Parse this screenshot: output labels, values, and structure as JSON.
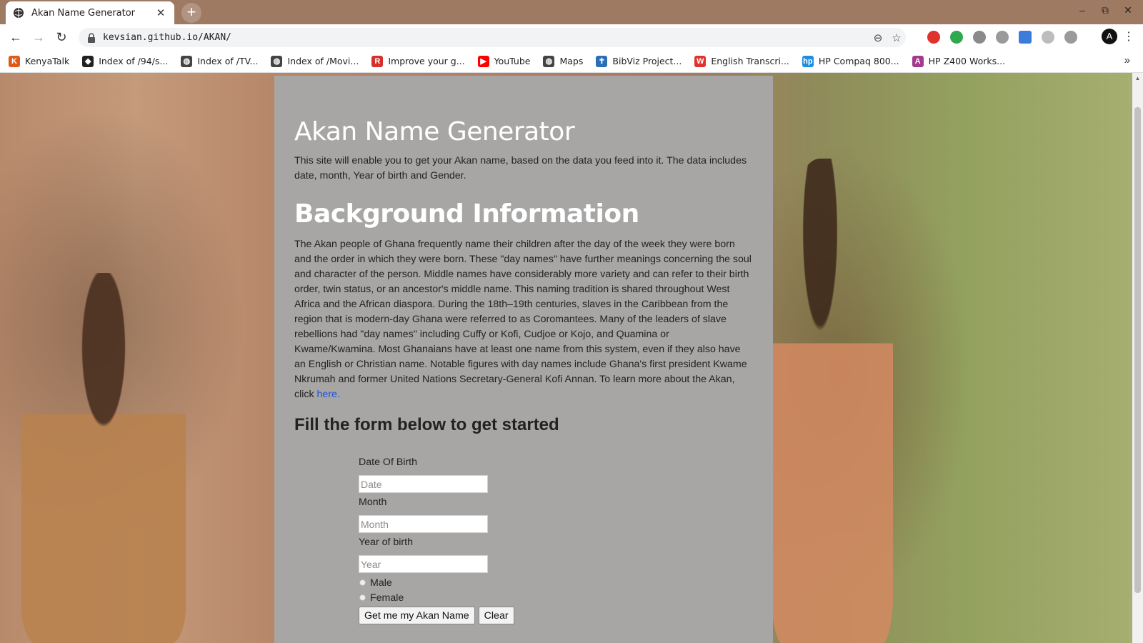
{
  "browser": {
    "tab_title": "Akan Name Generator",
    "tab_close": "✕",
    "new_tab": "+",
    "url": "kevsian.github.io/AKAN/",
    "window_controls": {
      "minimize": "–",
      "restore": "⧉",
      "close": "✕"
    },
    "nav": {
      "back": "←",
      "forward": "→",
      "reload": "↻"
    },
    "omnibox_icons": {
      "zoom": "⊖",
      "star": "☆"
    },
    "menu": "⋮",
    "profile_initial": "A"
  },
  "bookmarks": {
    "items": [
      {
        "label": "KenyaTalk",
        "icon": "K",
        "color": "#e05a1a"
      },
      {
        "label": "Index of /94/s...",
        "icon": "◆",
        "color": "#222222"
      },
      {
        "label": "Index of /TV...",
        "icon": "◍",
        "color": "#444444"
      },
      {
        "label": "Index of /Movi...",
        "icon": "◍",
        "color": "#444444"
      },
      {
        "label": "Improve your g...",
        "icon": "R",
        "color": "#d3312a"
      },
      {
        "label": "YouTube",
        "icon": "▶",
        "color": "#ff0000"
      },
      {
        "label": "Maps",
        "icon": "◍",
        "color": "#444444"
      },
      {
        "label": "BibViz Project...",
        "icon": "✝",
        "color": "#2a6fb5"
      },
      {
        "label": "English Transcri...",
        "icon": "W",
        "color": "#e1332d"
      },
      {
        "label": "HP Compaq 800...",
        "icon": "hp",
        "color": "#1d8ee0"
      },
      {
        "label": "HP Z400 Works...",
        "icon": "A",
        "color": "#a43b8f"
      }
    ],
    "more": "»"
  },
  "page": {
    "title": "Akan Name Generator",
    "intro": "This site will enable you to get your Akan name, based on the data you feed into it. The data includes date, month, Year of birth and Gender.",
    "background_title": "Background Information",
    "background_text": "The Akan people of Ghana frequently name their children after the day of the week they were born and the order in which they were born. These \"day names\" have further meanings concerning the soul and character of the person. Middle names have considerably more variety and can refer to their birth order, twin status, or an ancestor's middle name. This naming tradition is shared throughout West Africa and the African diaspora. During the 18th–19th centuries, slaves in the Caribbean from the region that is modern-day Ghana were referred to as Coromantees. Many of the leaders of slave rebellions had \"day names\" including Cuffy or Kofi, Cudjoe or Kojo, and Quamina or Kwame/Kwamina. Most Ghanaians have at least one name from this system, even if they also have an English or Christian name. Notable figures with day names include Ghana's first president Kwame Nkrumah and former United Nations Secretary-General Kofi Annan. To learn more about the Akan, click ",
    "link_text": "here.",
    "form_title": "Fill the form below to get started"
  },
  "form": {
    "date_label": "Date Of Birth",
    "date_placeholder": "Date",
    "month_label": "Month",
    "month_placeholder": "Month",
    "year_label": "Year of birth",
    "year_placeholder": "Year",
    "gender_male": "Male",
    "gender_female": "Female",
    "submit_label": "Get me my Akan Name",
    "clear_label": "Clear"
  }
}
